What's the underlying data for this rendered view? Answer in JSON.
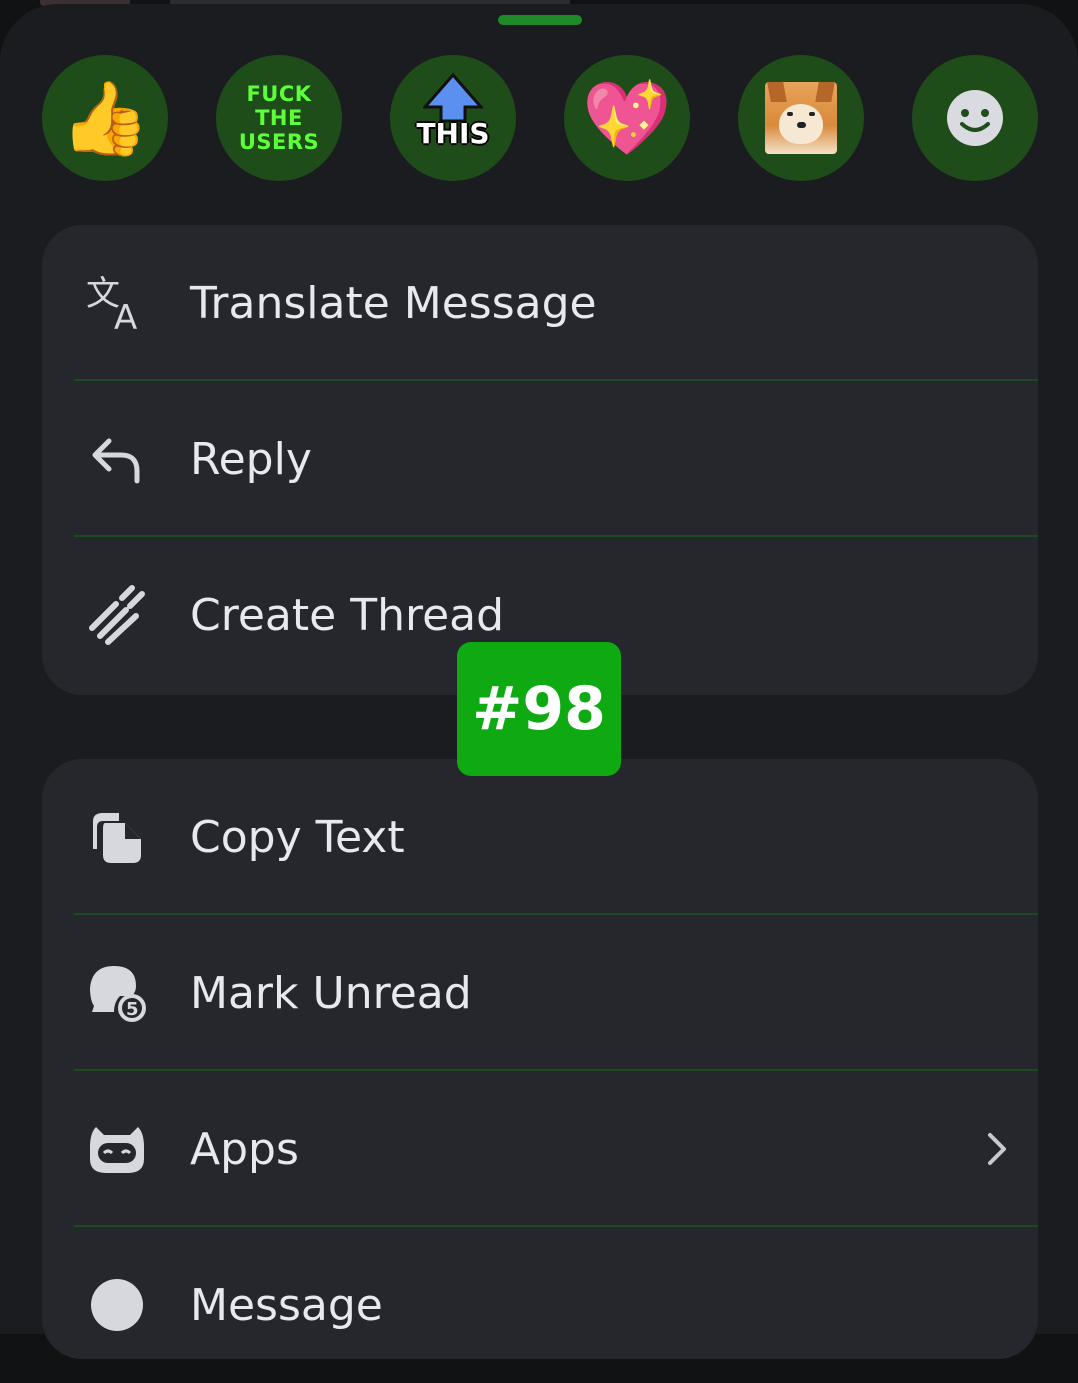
{
  "reactions": [
    {
      "name": "thumbs-up",
      "emoji": "👍"
    },
    {
      "name": "fuck-the-users-sticker",
      "lines": [
        "FUCK",
        "THE",
        "USERS"
      ]
    },
    {
      "name": "this-arrow-sticker",
      "text": "THIS"
    },
    {
      "name": "sparkling-heart",
      "emoji": "💖"
    },
    {
      "name": "doge",
      "image": "shiba-dog"
    },
    {
      "name": "add-reaction",
      "icon": "smiley-icon"
    }
  ],
  "menu_group_1": [
    {
      "label": "Translate Message",
      "icon": "translate-icon"
    },
    {
      "label": "Reply",
      "icon": "reply-icon"
    },
    {
      "label": "Create Thread",
      "icon": "thread-icon"
    }
  ],
  "menu_group_2": [
    {
      "label": "Copy Text",
      "icon": "copy-icon"
    },
    {
      "label": "Mark Unread",
      "icon": "mark-unread-icon"
    },
    {
      "label": "Apps",
      "icon": "apps-icon",
      "trailing_icon": "chevron-right-icon"
    },
    {
      "label": "Message",
      "icon": "message-icon"
    }
  ],
  "overlay_badge": {
    "text": "#98"
  },
  "colors": {
    "sheet": "#1b1c20",
    "card": "#26272c",
    "reaction_bg": "#1e4d1a",
    "divider": "#1c4a1f",
    "badge": "#0faa12",
    "text": "#e8e9ee"
  }
}
